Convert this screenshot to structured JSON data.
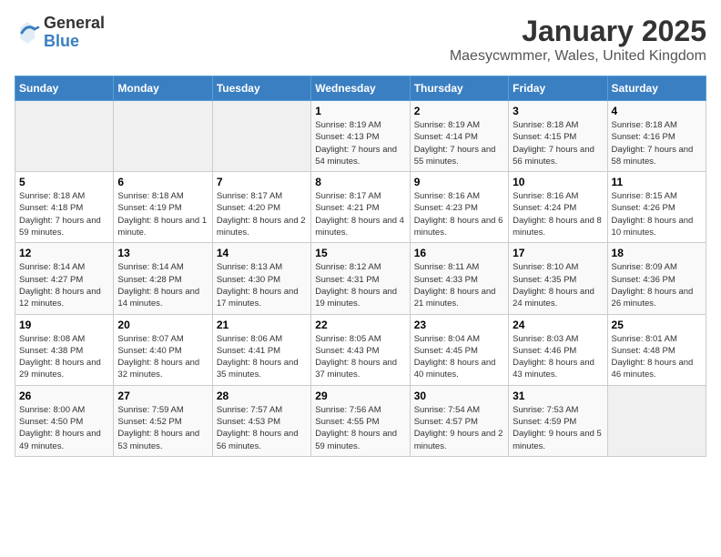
{
  "logo": {
    "text_general": "General",
    "text_blue": "Blue"
  },
  "header": {
    "month": "January 2025",
    "location": "Maesycwmmer, Wales, United Kingdom"
  },
  "days_of_week": [
    "Sunday",
    "Monday",
    "Tuesday",
    "Wednesday",
    "Thursday",
    "Friday",
    "Saturday"
  ],
  "weeks": [
    [
      {
        "day": "",
        "info": ""
      },
      {
        "day": "",
        "info": ""
      },
      {
        "day": "",
        "info": ""
      },
      {
        "day": "1",
        "info": "Sunrise: 8:19 AM\nSunset: 4:13 PM\nDaylight: 7 hours\nand 54 minutes."
      },
      {
        "day": "2",
        "info": "Sunrise: 8:19 AM\nSunset: 4:14 PM\nDaylight: 7 hours\nand 55 minutes."
      },
      {
        "day": "3",
        "info": "Sunrise: 8:18 AM\nSunset: 4:15 PM\nDaylight: 7 hours\nand 56 minutes."
      },
      {
        "day": "4",
        "info": "Sunrise: 8:18 AM\nSunset: 4:16 PM\nDaylight: 7 hours\nand 58 minutes."
      }
    ],
    [
      {
        "day": "5",
        "info": "Sunrise: 8:18 AM\nSunset: 4:18 PM\nDaylight: 7 hours\nand 59 minutes."
      },
      {
        "day": "6",
        "info": "Sunrise: 8:18 AM\nSunset: 4:19 PM\nDaylight: 8 hours\nand 1 minute."
      },
      {
        "day": "7",
        "info": "Sunrise: 8:17 AM\nSunset: 4:20 PM\nDaylight: 8 hours\nand 2 minutes."
      },
      {
        "day": "8",
        "info": "Sunrise: 8:17 AM\nSunset: 4:21 PM\nDaylight: 8 hours\nand 4 minutes."
      },
      {
        "day": "9",
        "info": "Sunrise: 8:16 AM\nSunset: 4:23 PM\nDaylight: 8 hours\nand 6 minutes."
      },
      {
        "day": "10",
        "info": "Sunrise: 8:16 AM\nSunset: 4:24 PM\nDaylight: 8 hours\nand 8 minutes."
      },
      {
        "day": "11",
        "info": "Sunrise: 8:15 AM\nSunset: 4:26 PM\nDaylight: 8 hours\nand 10 minutes."
      }
    ],
    [
      {
        "day": "12",
        "info": "Sunrise: 8:14 AM\nSunset: 4:27 PM\nDaylight: 8 hours\nand 12 minutes."
      },
      {
        "day": "13",
        "info": "Sunrise: 8:14 AM\nSunset: 4:28 PM\nDaylight: 8 hours\nand 14 minutes."
      },
      {
        "day": "14",
        "info": "Sunrise: 8:13 AM\nSunset: 4:30 PM\nDaylight: 8 hours\nand 17 minutes."
      },
      {
        "day": "15",
        "info": "Sunrise: 8:12 AM\nSunset: 4:31 PM\nDaylight: 8 hours\nand 19 minutes."
      },
      {
        "day": "16",
        "info": "Sunrise: 8:11 AM\nSunset: 4:33 PM\nDaylight: 8 hours\nand 21 minutes."
      },
      {
        "day": "17",
        "info": "Sunrise: 8:10 AM\nSunset: 4:35 PM\nDaylight: 8 hours\nand 24 minutes."
      },
      {
        "day": "18",
        "info": "Sunrise: 8:09 AM\nSunset: 4:36 PM\nDaylight: 8 hours\nand 26 minutes."
      }
    ],
    [
      {
        "day": "19",
        "info": "Sunrise: 8:08 AM\nSunset: 4:38 PM\nDaylight: 8 hours\nand 29 minutes."
      },
      {
        "day": "20",
        "info": "Sunrise: 8:07 AM\nSunset: 4:40 PM\nDaylight: 8 hours\nand 32 minutes."
      },
      {
        "day": "21",
        "info": "Sunrise: 8:06 AM\nSunset: 4:41 PM\nDaylight: 8 hours\nand 35 minutes."
      },
      {
        "day": "22",
        "info": "Sunrise: 8:05 AM\nSunset: 4:43 PM\nDaylight: 8 hours\nand 37 minutes."
      },
      {
        "day": "23",
        "info": "Sunrise: 8:04 AM\nSunset: 4:45 PM\nDaylight: 8 hours\nand 40 minutes."
      },
      {
        "day": "24",
        "info": "Sunrise: 8:03 AM\nSunset: 4:46 PM\nDaylight: 8 hours\nand 43 minutes."
      },
      {
        "day": "25",
        "info": "Sunrise: 8:01 AM\nSunset: 4:48 PM\nDaylight: 8 hours\nand 46 minutes."
      }
    ],
    [
      {
        "day": "26",
        "info": "Sunrise: 8:00 AM\nSunset: 4:50 PM\nDaylight: 8 hours\nand 49 minutes."
      },
      {
        "day": "27",
        "info": "Sunrise: 7:59 AM\nSunset: 4:52 PM\nDaylight: 8 hours\nand 53 minutes."
      },
      {
        "day": "28",
        "info": "Sunrise: 7:57 AM\nSunset: 4:53 PM\nDaylight: 8 hours\nand 56 minutes."
      },
      {
        "day": "29",
        "info": "Sunrise: 7:56 AM\nSunset: 4:55 PM\nDaylight: 8 hours\nand 59 minutes."
      },
      {
        "day": "30",
        "info": "Sunrise: 7:54 AM\nSunset: 4:57 PM\nDaylight: 9 hours\nand 2 minutes."
      },
      {
        "day": "31",
        "info": "Sunrise: 7:53 AM\nSunset: 4:59 PM\nDaylight: 9 hours\nand 5 minutes."
      },
      {
        "day": "",
        "info": ""
      }
    ]
  ]
}
